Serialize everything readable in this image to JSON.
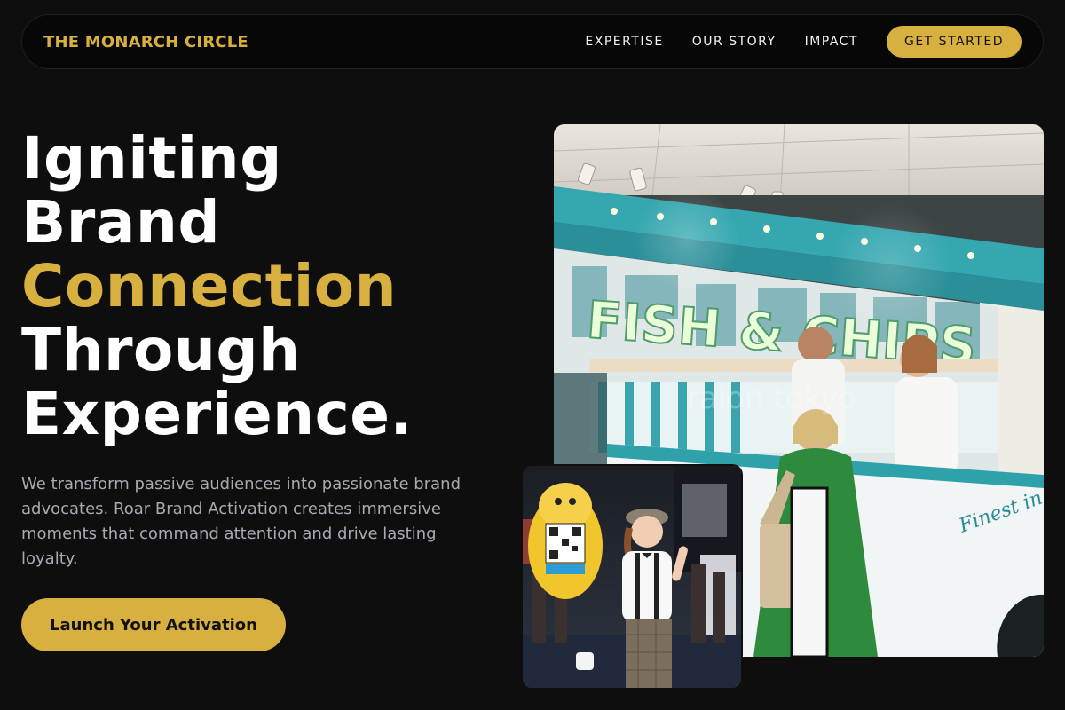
{
  "nav": {
    "brand": "THE MONARCH CIRCLE",
    "links": [
      "EXPERTISE",
      "OUR STORY",
      "IMPACT"
    ],
    "cta": "GET STARTED"
  },
  "hero": {
    "headline": [
      "Igniting",
      "Brand",
      "Connection",
      "Through",
      "Experience."
    ],
    "lede": "We transform passive audiences into passionate brand advocates. Roar Brand Activation creates immersive moments that command attention and drive lasting loyalty.",
    "cta": "Launch Your Activation"
  },
  "images": {
    "main": {
      "sign": "FISH & CHIPS",
      "script": "Finest in London",
      "watermark": "raion tokyo"
    }
  },
  "colors": {
    "accent": "#d8b03f",
    "background": "#0e0e0f",
    "nav_bg": "#070707",
    "muted_text": "#a8a9b3"
  }
}
